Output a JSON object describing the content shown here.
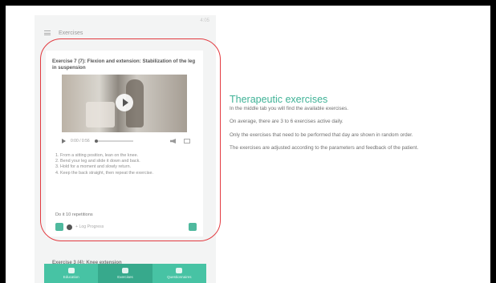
{
  "slide": {
    "accent_color": "#3fb296",
    "highlight_color": "#e23a40"
  },
  "phone": {
    "status_text": "4:05",
    "app_bar": {
      "menu_icon": "hamburger-menu-icon",
      "title": "Exercises"
    },
    "exercise_card": {
      "title": "Exercise 7 (7): Flexion and extension: Stabilization of the leg in suspension",
      "video_controls": {
        "time": "0:00 / 0:56"
      },
      "instructions": [
        "1. From a sitting position, lean on the knee.",
        "2. Bend your leg and slide it down and back.",
        "3. Hold for a moment and slowly return.",
        "4. Keep the back straight, then repeat the exercise."
      ],
      "repeat_label": "Do it 10 repetitions",
      "log_placeholder": "+ Log Progress"
    },
    "next_exercise_title": "Exercise 3 (4): Knee extension",
    "bottom_nav": [
      {
        "label": "Education",
        "icon": "book-icon"
      },
      {
        "label": "Exercises",
        "icon": "exercise-icon"
      },
      {
        "label": "Questionnaires",
        "icon": "list-icon"
      }
    ]
  },
  "content": {
    "heading": "Therapeutic exercises",
    "paragraphs": [
      "In the middle tab you will find the available exercises.",
      "On average, there are 3 to 6 exercises active daily.",
      "Only the exercises that need to be performed that day are shown in random order.",
      "The exercises are adjusted according to the parameters and feedback of the patient."
    ]
  }
}
